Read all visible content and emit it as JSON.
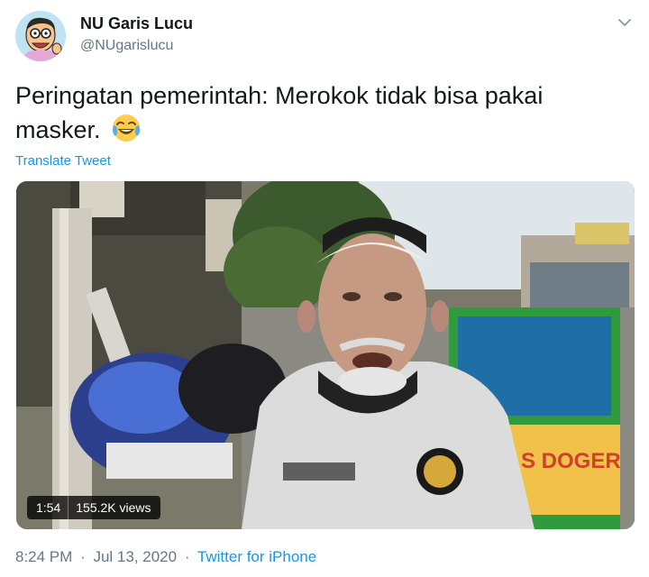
{
  "tweet": {
    "author_name": "NU Garis Lucu",
    "author_handle": "@NUgarislucu",
    "text_line1": "Peringatan pemerintah: Merokok tidak bisa pakai",
    "text_line2": "masker.",
    "emoji": "face-with-tears-of-joy",
    "translate_label": "Translate Tweet",
    "time": "8:24 PM",
    "date": "Jul 13, 2020",
    "separator": "·",
    "source": "Twitter for iPhone"
  },
  "video": {
    "duration": "1:54",
    "views": "155.2K views",
    "sign_text": "S DOGER"
  },
  "colors": {
    "link": "#1b95e0",
    "secondary_text": "#657786",
    "primary_text": "#14171a"
  }
}
